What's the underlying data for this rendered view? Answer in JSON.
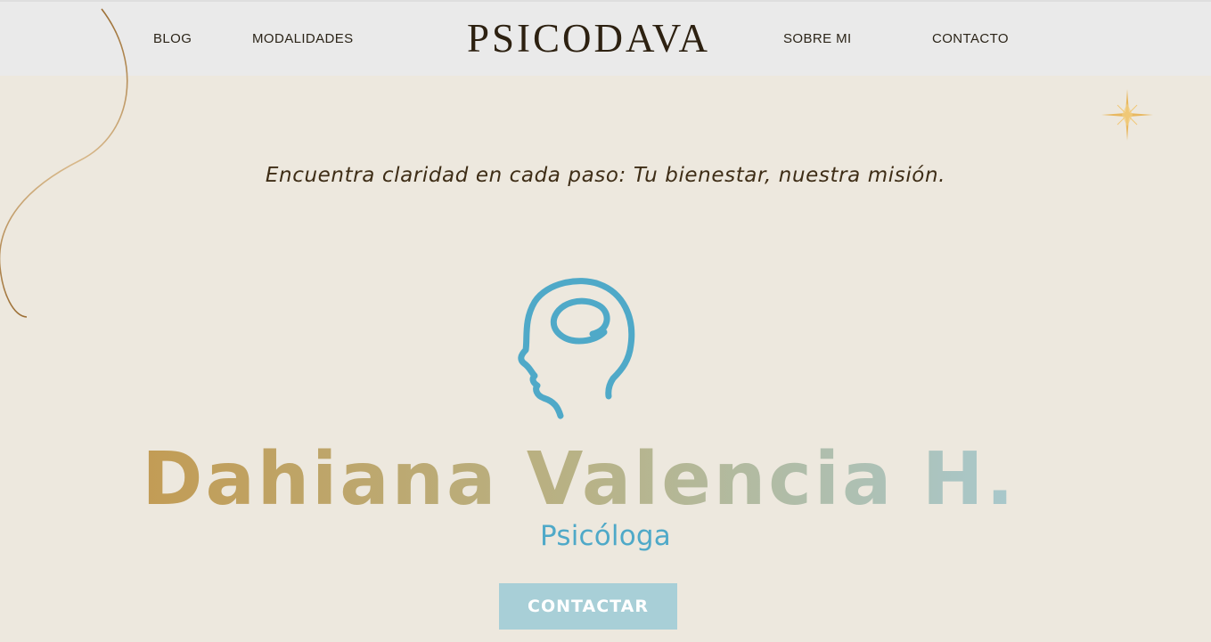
{
  "nav": {
    "blog_label": "BLOG",
    "modalidades_label": "MODALIDADES",
    "brand": "PSICODAVA",
    "sobre_mi_label": "SOBRE MI",
    "contacto_label": "CONTACTO"
  },
  "hero": {
    "tagline": "Encuentra claridad en cada paso: Tu bienestar, nuestra misión.",
    "logo_name": "Dahiana Valencia H.",
    "logo_subtitle": "Psicóloga",
    "cta_label": "CONTACTAR"
  },
  "colors": {
    "nav_background": "#eaeaea",
    "page_background": "#ede8de",
    "brand_text": "#2d2111",
    "logo_blue": "#4fa9c8",
    "gradient_start": "#c29c55",
    "gradient_end": "#a8c8cc",
    "cta_background": "#a8cfd7",
    "sparkle_gold": "#e8b860"
  },
  "icons": {
    "head": "head-profile-icon",
    "sparkle": "sparkle-star-icon"
  }
}
